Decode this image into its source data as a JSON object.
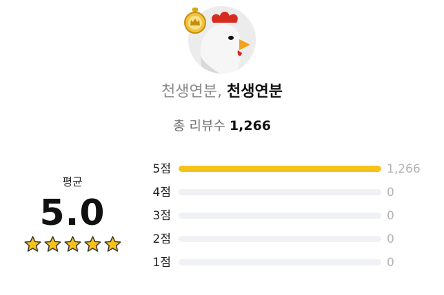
{
  "profile": {
    "avatar_alt": "chicken character avatar",
    "badge_icon": "crown-medal-icon",
    "name_primary": "천생연분,",
    "name_secondary": "천생연분"
  },
  "summary": {
    "total_label": "총 리뷰수",
    "total_count": "1,266"
  },
  "average": {
    "label": "평균",
    "score": "5.0",
    "stars": 5,
    "star_color": "#f7c21a"
  },
  "distribution": {
    "bar_color": "#f7c21a",
    "track_color": "#f0f1f4",
    "rows": [
      {
        "label": "5점",
        "count": "1,266",
        "fraction": 1.0
      },
      {
        "label": "4점",
        "count": "0",
        "fraction": 0
      },
      {
        "label": "3점",
        "count": "0",
        "fraction": 0
      },
      {
        "label": "2점",
        "count": "0",
        "fraction": 0
      },
      {
        "label": "1점",
        "count": "0",
        "fraction": 0
      }
    ]
  }
}
